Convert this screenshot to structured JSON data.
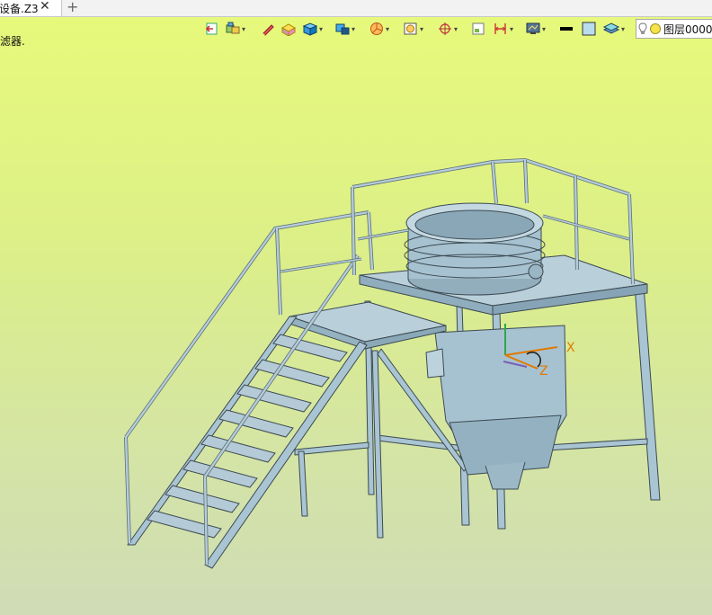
{
  "tab": {
    "title": "设备.Z3",
    "close_glyph": "✕",
    "add_glyph": "+"
  },
  "status_hint": "滤器.",
  "toolbar": {
    "icons": [
      "exit-icon",
      "assembly-icon",
      "sketch-pen-icon",
      "shape-block-icon",
      "solid-cube-icon",
      "view-display-icon",
      "section-icon",
      "render-style-icon",
      "target-icon",
      "bounding-box-icon",
      "dimension-icon",
      "monitor-view-icon",
      "line-color-icon",
      "fill-color-icon",
      "layer-stack-icon"
    ],
    "layer_label": "图层0000"
  },
  "triad": {
    "x_label": "X",
    "z_label": "Z"
  },
  "colors": {
    "accent": "#e07a00",
    "model": "#a9c4d2",
    "model_edge": "#3c4a52"
  }
}
